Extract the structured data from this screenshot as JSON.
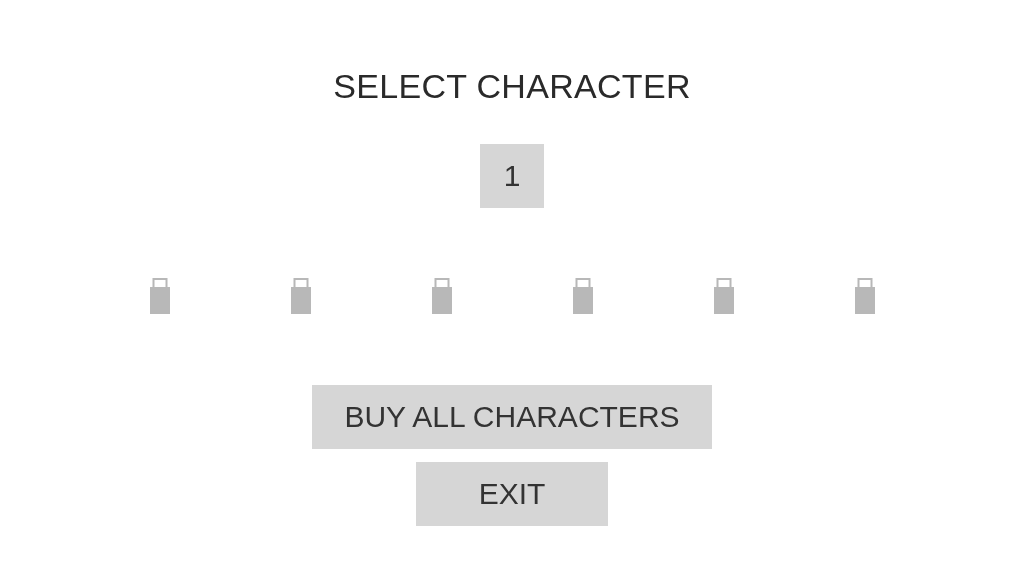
{
  "title": "SELECT CHARACTER",
  "character_number": "1",
  "characters": [
    {
      "locked": true
    },
    {
      "locked": true
    },
    {
      "locked": true
    },
    {
      "locked": true
    },
    {
      "locked": true
    },
    {
      "locked": true
    }
  ],
  "buttons": [
    {
      "label": "BUY ALL CHARACTERS",
      "kind": "buy"
    },
    {
      "label": "EXIT",
      "kind": "exit"
    }
  ]
}
